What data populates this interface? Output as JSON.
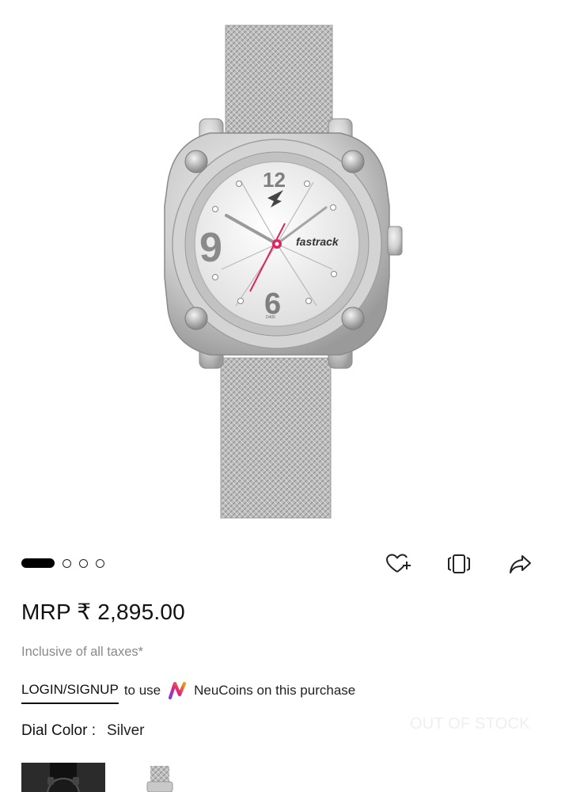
{
  "product": {
    "brand_logo_text": "fastrack",
    "dial_numerals": [
      "12",
      "9",
      "6"
    ],
    "dial_code": "D405",
    "image_icon": "watch-product-image",
    "colors": {
      "case": "#c9c9c9",
      "dial": "#eeeeee",
      "accent_hand": "#e0245e"
    }
  },
  "carousel": {
    "total": 4,
    "active_index": 0
  },
  "actions": [
    {
      "name": "wishlist-add-icon"
    },
    {
      "name": "compare-icon"
    },
    {
      "name": "share-icon"
    }
  ],
  "pricing": {
    "price_text": "MRP ₹ 2,895.00",
    "tax_note": "Inclusive of all taxes*"
  },
  "neucoins": {
    "login_text": "LOGIN/SIGNUP",
    "to_use_text": "to use",
    "icon": "neucoins-icon",
    "purchase_text": "NeuCoins on this purchase"
  },
  "dial": {
    "label": "Dial Color :",
    "value": "Silver"
  },
  "stock": {
    "status_text": "OUT OF STOCK"
  },
  "variants": [
    {
      "name": "black-watch-variant"
    },
    {
      "name": "silver-watch-variant"
    }
  ]
}
